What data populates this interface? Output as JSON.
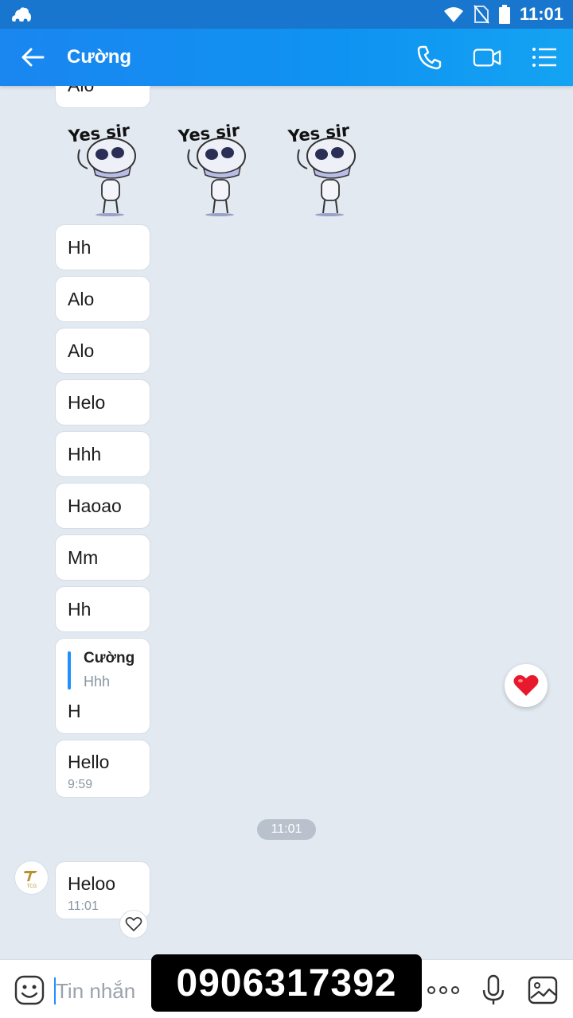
{
  "status_bar": {
    "time": "11:01"
  },
  "header": {
    "title": "Cường"
  },
  "chat": {
    "top_partial_message": "Alo",
    "sticker_text": "Yes sir",
    "messages": [
      "Hh",
      "Alo",
      "Alo",
      "Helo",
      "Hhh",
      "Haoao",
      "Mm",
      "Hh"
    ],
    "reply_message": {
      "quoted_name": "Cường",
      "quoted_text": "Hhh",
      "text": "H"
    },
    "hello_message": {
      "text": "Hello",
      "time": "9:59"
    },
    "time_separator": "11:01",
    "last_message": {
      "text": "Heloo",
      "time": "11:01"
    },
    "avatar_text": "TCG"
  },
  "input": {
    "placeholder": "Tin nhắn"
  },
  "overlay": {
    "phone_number": "0906317392"
  },
  "colors": {
    "header": "#1a86f0",
    "background": "#e2e9f1",
    "accent": "#1e90ff",
    "heart": "#e8192c"
  }
}
